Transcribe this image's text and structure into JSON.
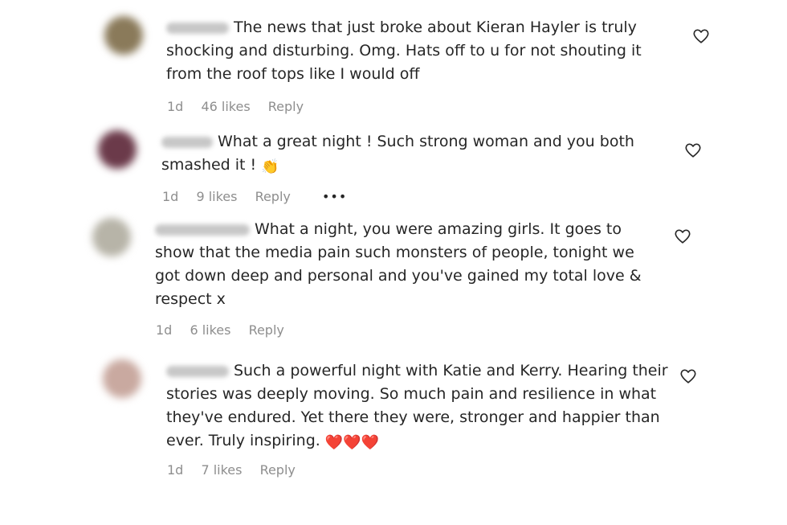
{
  "comments": [
    {
      "text": "The news that just broke about Kieran Hayler is truly shocking and disturbing. Omg. Hats off to u for not shouting it from the roof tops like I would off",
      "time": "1d",
      "likes": "46 likes",
      "reply": "Reply",
      "avatar_color": "#8a7a5a"
    },
    {
      "text": "What a great night ! Such strong woman and you both smashed it !",
      "emoji": "👏",
      "time": "1d",
      "likes": "9 likes",
      "reply": "Reply",
      "more": "•••",
      "avatar_color": "#6b3a4a"
    },
    {
      "text": "What a night, you were amazing girls. It goes to show that the media pain such monsters of people, tonight we got down deep and personal and you've gained my total love & respect x",
      "time": "1d",
      "likes": "6 likes",
      "reply": "Reply",
      "avatar_color": "#b7b4a8"
    },
    {
      "text": "Such a powerful night with Katie and Kerry. Hearing their stories was deeply moving. So much pain and resilience in what they've endured. Yet there they were, stronger and happier than ever. Truly inspiring.",
      "emoji": "❤️❤️❤️",
      "time": "1d",
      "likes": "7 likes",
      "reply": "Reply",
      "avatar_color": "#c9a9a0"
    }
  ],
  "icons": {
    "like": "heart-outline-icon"
  }
}
